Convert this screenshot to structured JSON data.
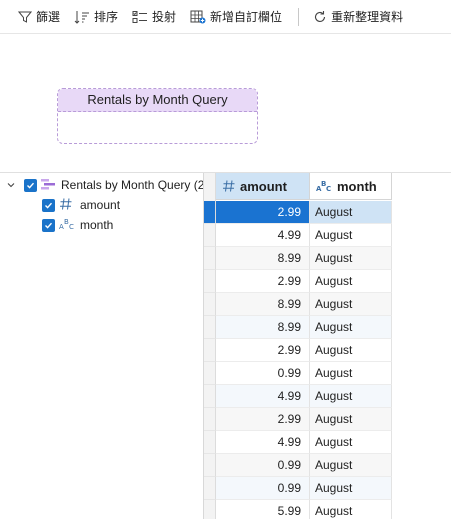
{
  "toolbar": {
    "filter_label": "篩選",
    "sort_label": "排序",
    "project_label": "投射",
    "add_column_label": "新增自訂欄位",
    "refresh_label": "重新整理資料"
  },
  "canvas": {
    "query_title": "Rentals by Month Query"
  },
  "tree": {
    "root_label": "Rentals by Month Query (2",
    "fields": [
      {
        "label": "amount",
        "icon": "number-icon"
      },
      {
        "label": "month",
        "icon": "text-type-icon"
      }
    ]
  },
  "grid": {
    "columns": [
      "amount",
      "month"
    ],
    "rows": [
      [
        "2.99",
        "August"
      ],
      [
        "4.99",
        "August"
      ],
      [
        "8.99",
        "August"
      ],
      [
        "2.99",
        "August"
      ],
      [
        "8.99",
        "August"
      ],
      [
        "8.99",
        "August"
      ],
      [
        "2.99",
        "August"
      ],
      [
        "0.99",
        "August"
      ],
      [
        "4.99",
        "August"
      ],
      [
        "2.99",
        "August"
      ],
      [
        "4.99",
        "August"
      ],
      [
        "0.99",
        "August"
      ],
      [
        "0.99",
        "August"
      ],
      [
        "5.99",
        "August"
      ]
    ]
  },
  "colors": {
    "accent": "#1a73d1",
    "query_header": "#e8d9f7",
    "selected_header": "#cfe3f5"
  }
}
